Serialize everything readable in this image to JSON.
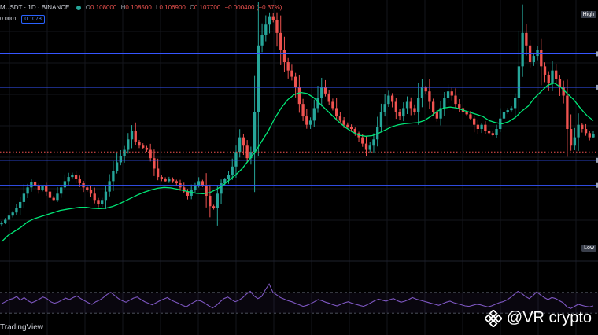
{
  "header": {
    "symbol": "MUSDT · 1D · BINANCE",
    "o_label": "O",
    "o_value": "0.108000",
    "h_label": "H",
    "h_value": "0.108500",
    "l_label": "L",
    "l_value": "0.106900",
    "c_label": "C",
    "c_value": "0.107700",
    "change": "−0.000400 (−0.37%)",
    "step": "0.0001",
    "price_box": "0.1078",
    "status_color": "#26a69a"
  },
  "badges": {
    "high": "High",
    "low": "Low"
  },
  "branding": {
    "tradingview": "TradingView",
    "watermark": "@VR crypto"
  },
  "colors": {
    "bull": "#26a69a",
    "bear": "#ef5350",
    "ma": "#00e676",
    "level": "#3656ff",
    "current": "#ef5350",
    "rsi": "#7e57c2"
  },
  "chart_data": {
    "type": "line",
    "series": [
      {
        "values": [
          0.065,
          0.0665,
          0.0685,
          0.07,
          0.072,
          0.075,
          0.079,
          0.082,
          0.0845,
          0.083,
          0.081,
          0.0825,
          0.08,
          0.077,
          0.076,
          0.079,
          0.082,
          0.085,
          0.087,
          0.088,
          0.086,
          0.084,
          0.082,
          0.081,
          0.079,
          0.076,
          0.074,
          0.076,
          0.08,
          0.085,
          0.09,
          0.094,
          0.097,
          0.1,
          0.105,
          0.109,
          0.104,
          0.102,
          0.101,
          0.1,
          0.096,
          0.091,
          0.087,
          0.086,
          0.085,
          0.086,
          0.085,
          0.084,
          0.082,
          0.08,
          0.078,
          0.081,
          0.083,
          0.085,
          0.083,
          0.078,
          0.073,
          0.072,
          0.079,
          0.084,
          0.086,
          0.088,
          0.092,
          0.099,
          0.106,
          0.102,
          0.096,
          0.099,
          0.118,
          0.15,
          0.155,
          0.16,
          0.164,
          0.162,
          0.156,
          0.148,
          0.142,
          0.138,
          0.135,
          0.13,
          0.122,
          0.116,
          0.112,
          0.114,
          0.12,
          0.125,
          0.13,
          0.127,
          0.123,
          0.12,
          0.116,
          0.114,
          0.112,
          0.111,
          0.11,
          0.108,
          0.106,
          0.103,
          0.1,
          0.102,
          0.105,
          0.111,
          0.118,
          0.122,
          0.126,
          0.123,
          0.118,
          0.116,
          0.12,
          0.123,
          0.12,
          0.118,
          0.125,
          0.13,
          0.128,
          0.123,
          0.118,
          0.115,
          0.12,
          0.125,
          0.128,
          0.126,
          0.122,
          0.12,
          0.118,
          0.117,
          0.115,
          0.112,
          0.11,
          0.112,
          0.109,
          0.108,
          0.107,
          0.11,
          0.115,
          0.118,
          0.119,
          0.12,
          0.125,
          0.14,
          0.156,
          0.15,
          0.142,
          0.145,
          0.148,
          0.14,
          0.136,
          0.132,
          0.138,
          0.134,
          0.13,
          0.126,
          0.11,
          0.102,
          0.106,
          0.112,
          0.11,
          0.108,
          0.106,
          0.1077
        ]
      },
      {
        "values": [
          0.056,
          0.059,
          0.061,
          0.063,
          0.0655,
          0.067,
          0.068,
          0.069,
          0.07,
          0.071,
          0.0715,
          0.072,
          0.0725,
          0.0725,
          0.072,
          0.0718,
          0.072,
          0.0728,
          0.074,
          0.0755,
          0.077,
          0.0785,
          0.0798,
          0.0808,
          0.0816,
          0.082,
          0.0818,
          0.0812,
          0.0805,
          0.0798,
          0.0792,
          0.079,
          0.0795,
          0.081,
          0.083,
          0.0855,
          0.088,
          0.091,
          0.095,
          0.099,
          0.104,
          0.109,
          0.115,
          0.12,
          0.124,
          0.1265,
          0.1275,
          0.127,
          0.125,
          0.122,
          0.119,
          0.116,
          0.113,
          0.1105,
          0.1085,
          0.107,
          0.1065,
          0.1068,
          0.108,
          0.1095,
          0.111,
          0.112,
          0.1125,
          0.1128,
          0.113,
          0.114,
          0.116,
          0.1185,
          0.12,
          0.1205,
          0.12,
          0.119,
          0.118,
          0.117,
          0.116,
          0.114,
          0.113,
          0.1125,
          0.1135,
          0.1155,
          0.1185,
          0.121,
          0.125,
          0.128,
          0.131,
          0.132,
          0.13,
          0.127,
          0.124,
          0.12,
          0.1165,
          0.114
        ]
      },
      {
        "values": [
          48,
          52,
          56,
          58,
          62,
          55,
          60,
          54,
          50,
          53,
          57,
          61,
          58,
          52,
          49,
          51,
          55,
          59,
          56,
          60,
          63,
          58,
          54,
          50,
          47,
          52,
          55,
          60,
          66,
          70,
          64,
          58,
          54,
          51,
          55,
          59,
          61,
          56,
          52,
          49,
          46,
          50,
          54,
          57,
          60,
          55,
          52,
          49,
          45,
          42,
          47,
          51,
          55,
          53,
          49,
          44,
          40,
          45,
          52,
          58,
          61,
          56,
          52,
          55,
          60,
          67,
          72,
          63,
          58,
          62,
          75,
          86,
          70,
          65,
          60,
          57,
          54,
          52,
          49,
          46,
          43,
          45,
          48,
          52,
          56,
          54,
          51,
          49,
          46,
          44,
          47,
          50,
          52,
          49,
          47,
          45,
          43,
          46,
          50,
          54,
          57,
          55,
          53,
          56,
          58,
          54,
          51,
          53,
          56,
          60,
          57,
          55,
          53,
          51,
          49,
          47,
          45,
          48,
          51,
          53,
          50,
          48,
          46,
          44,
          43,
          45,
          47,
          46,
          44,
          42,
          44,
          47,
          50,
          52,
          55,
          60,
          66,
          72,
          68,
          62,
          58,
          64,
          71,
          65,
          60,
          56,
          60,
          58,
          54,
          50,
          42,
          39,
          43,
          47,
          45,
          43,
          42,
          44
        ]
      }
    ],
    "ylim": [
      0.052,
      0.168
    ],
    "levels": [
      0.146,
      0.13,
      0.095,
      0.083
    ],
    "current_price": 0.099,
    "rsi_levels": [
      70,
      30
    ]
  }
}
